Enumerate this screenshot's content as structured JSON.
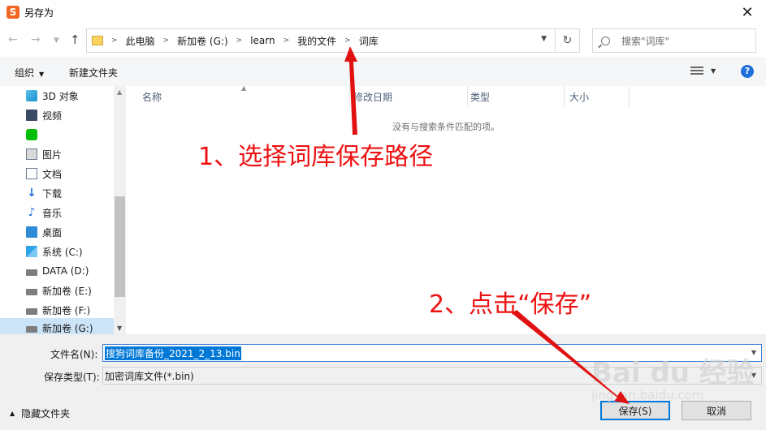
{
  "window": {
    "title": "另存为",
    "app_icon_letter": "S"
  },
  "address": {
    "crumbs": [
      "此电脑",
      "新加卷 (G:)",
      "learn",
      "我的文件",
      "词库"
    ],
    "search_placeholder": "搜索\"词库\""
  },
  "toolbar": {
    "organize": "组织",
    "new_folder": "新建文件夹",
    "help": "?"
  },
  "sidebar": {
    "items": [
      {
        "label": "3D 对象",
        "icon": "3d-objects-icon"
      },
      {
        "label": "视频",
        "icon": "video-icon"
      },
      {
        "label": "",
        "icon": "iqiyi-icon"
      },
      {
        "label": "图片",
        "icon": "pictures-icon"
      },
      {
        "label": "文档",
        "icon": "documents-icon"
      },
      {
        "label": "下载",
        "icon": "downloads-icon"
      },
      {
        "label": "音乐",
        "icon": "music-icon"
      },
      {
        "label": "桌面",
        "icon": "desktop-icon"
      },
      {
        "label": "系统 (C:)",
        "icon": "system-drive-icon"
      },
      {
        "label": "DATA (D:)",
        "icon": "drive-icon"
      },
      {
        "label": "新加卷 (E:)",
        "icon": "drive-icon"
      },
      {
        "label": "新加卷 (F:)",
        "icon": "drive-icon"
      },
      {
        "label": "新加卷 (G:)",
        "icon": "drive-icon",
        "selected": true
      }
    ]
  },
  "filelist": {
    "columns": [
      "名称",
      "修改日期",
      "类型",
      "大小"
    ],
    "empty_message": "没有与搜索条件匹配的项。"
  },
  "form": {
    "filename_label": "文件名(N):",
    "filename_value": "搜狗词库备份_2021_2_13.bin",
    "filetype_label": "保存类型(T):",
    "filetype_value": "加密词库文件(*.bin)",
    "hide_folders": "隐藏文件夹",
    "save_button": "保存(S)",
    "cancel_button": "取消"
  },
  "annotations": {
    "step1": "1、选择词库保存路径",
    "step2": "2、点击“保存”",
    "color": "#e11111"
  },
  "watermark": {
    "main": "Bai du 经验",
    "sub": "jingyan.baidu.com"
  },
  "colors": {
    "selection": "#cce4f7",
    "accent": "#0078d7"
  }
}
